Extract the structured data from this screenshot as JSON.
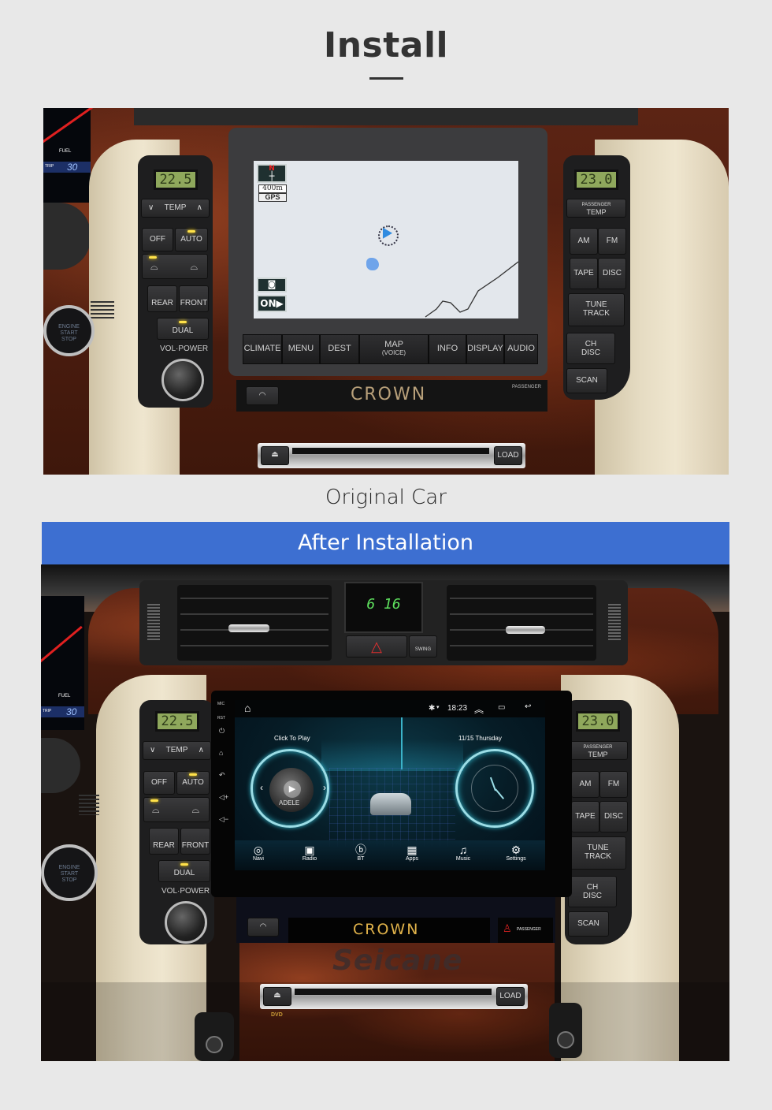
{
  "header": {
    "title": "Install"
  },
  "original": {
    "caption": "Original Car",
    "left_climate": {
      "temp_display": "22.5",
      "temp_label": "TEMP",
      "buttons": [
        "OFF",
        "AUTO",
        "REAR",
        "FRONT",
        "DUAL"
      ],
      "knob_label": "VOL·POWER"
    },
    "right_panel": {
      "temp_display": "23.0",
      "temp_label_top": "PASSENGER",
      "temp_label": "TEMP",
      "buttons": [
        "AM",
        "FM",
        "TAPE",
        "DISC"
      ],
      "tune_top": "TUNE",
      "tune_bottom": "TRACK",
      "ch_top": "CH",
      "ch_bottom": "DISC",
      "scan": "SCAN"
    },
    "engine_button": [
      "ENGINE",
      "START",
      "STOP"
    ],
    "cluster": {
      "fuel_label": "FUEL",
      "trip_label": "TRIP",
      "trip_value": "30"
    },
    "nav": {
      "north": "N",
      "scale": "400m",
      "gps": "GPS",
      "on_button": "ON",
      "hard_keys": [
        "CLIMATE",
        "MENU",
        "DEST",
        "MAP",
        "INFO",
        "DISPLAY",
        "AUDIO"
      ],
      "map_sub": "(VOICE)"
    },
    "brand": "CROWN",
    "passenger_label": "PASSENGER",
    "load_label": "LOAD"
  },
  "after": {
    "banner": "After Installation",
    "clock_display": "6 16",
    "swing_label": "SWING",
    "left_climate": {
      "temp_display": "22.5",
      "temp_label": "TEMP",
      "buttons": [
        "OFF",
        "AUTO",
        "REAR",
        "FRONT",
        "DUAL"
      ],
      "knob_label": "VOL·POWER"
    },
    "right_panel": {
      "temp_display": "23.0",
      "temp_label_top": "PASSENGER",
      "temp_label": "TEMP",
      "buttons": [
        "AM",
        "FM",
        "TAPE",
        "DISC"
      ],
      "tune_top": "TUNE",
      "tune_bottom": "TRACK",
      "ch_top": "CH",
      "ch_bottom": "DISC",
      "scan": "SCAN"
    },
    "engine_button": [
      "ENGINE",
      "START",
      "STOP"
    ],
    "cluster": {
      "fuel_label": "FUEL",
      "trip_label": "TRIP",
      "trip_value": "30"
    },
    "head_unit": {
      "side_labels": {
        "mic": "MIC",
        "rst": "RST"
      },
      "status": {
        "time": "18:23"
      },
      "music_widget": {
        "label": "Click To Play",
        "album_text": "ADELE"
      },
      "date_widget": {
        "label": "11/15 Thursday"
      },
      "apps": [
        {
          "label": "Navi",
          "icon": "location-pin-icon"
        },
        {
          "label": "Radio",
          "icon": "radio-icon"
        },
        {
          "label": "BT",
          "icon": "bluetooth-icon"
        },
        {
          "label": "Apps",
          "icon": "apps-grid-icon"
        },
        {
          "label": "Music",
          "icon": "music-note-icon"
        },
        {
          "label": "Settings",
          "icon": "settings-gear-icon"
        }
      ]
    },
    "brand": "CROWN",
    "passenger_label": "PASSENGER",
    "watermark": "Seicane",
    "load_label": "LOAD",
    "dvd_label": "DVD"
  },
  "colors": {
    "banner": "#3d6fd1",
    "title": "#333333",
    "background": "#e8e8e8"
  }
}
